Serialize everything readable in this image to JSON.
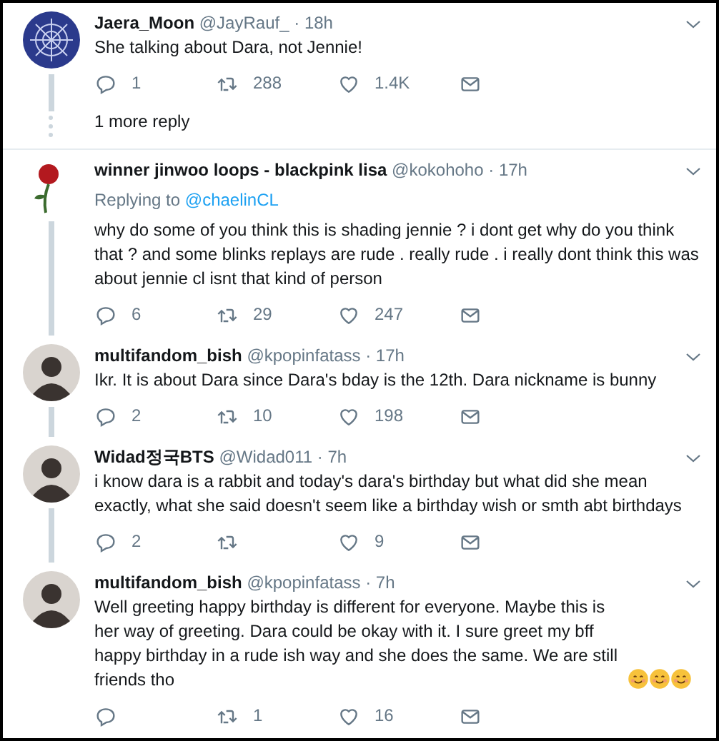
{
  "tweets": [
    {
      "avatar": {
        "kind": "emblem"
      },
      "name": "Jaera_Moon",
      "handle": "@JayRauf_",
      "time": "· 18h",
      "text": "She talking about Dara, not Jennie!",
      "replies": "1",
      "retweets": "288",
      "likes": "1.4K",
      "thread_line": true,
      "more_replies": "1 more reply"
    },
    {
      "avatar": {
        "kind": "rose"
      },
      "name": "winner jinwoo loops - blackpink lisa",
      "handle": "@kokohoho",
      "time": "· 17h",
      "replying_label": "Replying to",
      "replying_handle": "@chaelinCL",
      "text": "why do some of you think this is shading jennie ? i dont get why do you think that ? and some blinks replays are rude .  really rude . i really dont think this was about jennie cl isnt that kind of person",
      "replies": "6",
      "retweets": "29",
      "likes": "247",
      "thread_line": true
    },
    {
      "avatar": {
        "kind": "person"
      },
      "name": "multifandom_bish",
      "handle": "@kpopinfatass",
      "time": "· 17h",
      "text": "Ikr. It is about Dara since Dara's bday is the 12th. Dara nickname is bunny",
      "replies": "2",
      "retweets": "10",
      "likes": "198",
      "thread_line": true
    },
    {
      "avatar": {
        "kind": "person"
      },
      "name": "Widad정국BTS",
      "handle": "@Widad011",
      "time": "· 7h",
      "text": "i know dara is a rabbit and today's dara's birthday but what did she mean exactly, what she said doesn't seem like a birthday wish or smth abt birthdays",
      "replies": "2",
      "likes": "9",
      "thread_line": true
    },
    {
      "avatar": {
        "kind": "person"
      },
      "name": "multifandom_bish",
      "handle": "@kpopinfatass",
      "time": "· 7h",
      "text": "Well greeting happy birthday is different for everyone. Maybe this is her way of greeting. Dara could be okay with it. I sure greet my bff happy birthday in a rude ish way and she does the same. We are still friends tho",
      "emojis": [
        {
          "kind": "smile"
        },
        {
          "kind": "smile"
        },
        {
          "kind": "smile"
        }
      ],
      "retweets": "1",
      "likes": "16",
      "thread_line": false
    }
  ]
}
